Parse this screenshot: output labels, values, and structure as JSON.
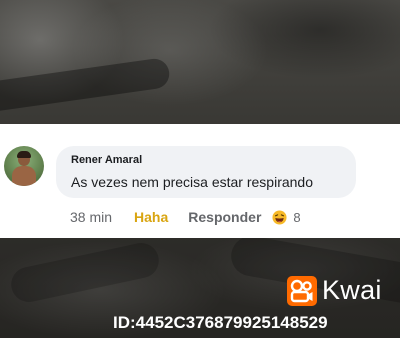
{
  "comment": {
    "author": "Rener Amaral",
    "text": "As vezes nem precisa estar respirando",
    "time": "38 min",
    "reaction_label": "Haha",
    "reply_label": "Responder",
    "reaction_icon": "laughing-emoji-icon",
    "reaction_count": "8"
  },
  "watermark": {
    "brand": "Kwai",
    "logo_icon": "kwai-logo-icon",
    "id_text": "ID:4452C37687992514852​9"
  },
  "colors": {
    "haha": "#d9a511",
    "logo": "#ff6a00"
  }
}
